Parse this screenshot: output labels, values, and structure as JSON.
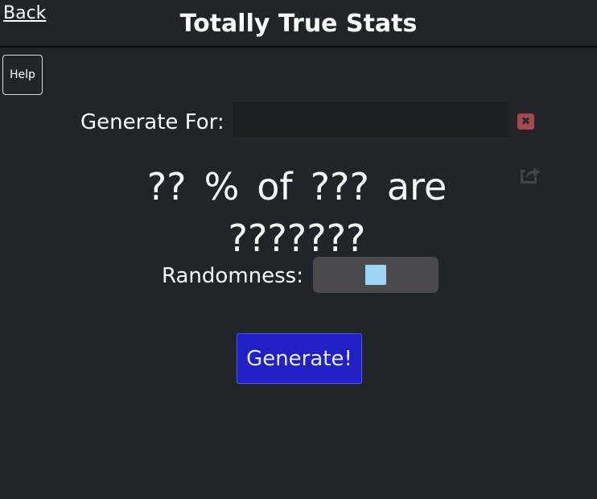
{
  "header": {
    "back_label": "Back",
    "title": "Totally True Stats",
    "help_label": "Help"
  },
  "generate_for": {
    "label": "Generate For:",
    "value": "",
    "clear_icon": "close-icon"
  },
  "stat": {
    "percent": "??",
    "percent_sign": "%",
    "of_word": "of",
    "group": "???",
    "are_word": "are",
    "trait": "???????",
    "share_icon": "share-icon"
  },
  "randomness": {
    "label": "Randomness:",
    "level": 0.5
  },
  "actions": {
    "generate_label": "Generate!"
  },
  "colors": {
    "background": "#212429",
    "input_background": "#1c1f22",
    "clear_button": "#a5494f",
    "slider_track": "#4a4a4c",
    "slider_thumb": "#9dd3f5",
    "generate_button": "#2020c4"
  }
}
